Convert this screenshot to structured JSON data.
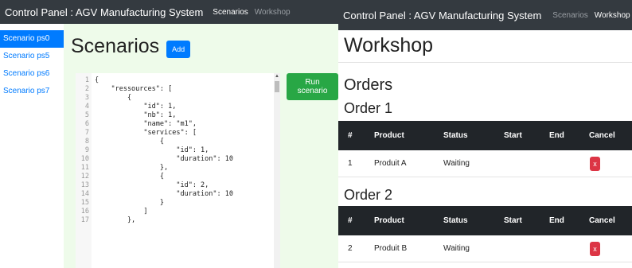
{
  "left": {
    "navbar": {
      "brand": "Control Panel : AGV Manufacturing System",
      "links": [
        "Scenarios",
        "Workshop"
      ]
    },
    "sidebar": {
      "items": [
        "Scenario ps0",
        "Scenario ps5",
        "Scenario ps6",
        "Scenario ps7"
      ],
      "active_index": 0
    },
    "title": "Scenarios",
    "add_label": "Add",
    "run_label": "Run scenario",
    "editor_lines": [
      "{",
      "    \"ressources\": [",
      "        {",
      "            \"id\": 1,",
      "            \"nb\": 1,",
      "            \"name\": \"m1\",",
      "            \"services\": [",
      "                {",
      "                    \"id\": 1,",
      "                    \"duration\": 10",
      "                },",
      "                {",
      "                    \"id\": 2,",
      "                    \"duration\": 10",
      "                }",
      "            ]",
      "        },"
    ]
  },
  "right": {
    "navbar": {
      "brand": "Control Panel : AGV Manufacturing System",
      "links": [
        "Scenarios",
        "Workshop"
      ]
    },
    "title": "Workshop",
    "orders_heading": "Orders",
    "columns": [
      "#",
      "Product",
      "Status",
      "Start",
      "End",
      "Cancel"
    ],
    "orders": [
      {
        "heading": "Order 1",
        "rows": [
          {
            "id": "1",
            "product": "Produit A",
            "status": "Waiting",
            "start": "",
            "end": "",
            "cancel": "x"
          }
        ]
      },
      {
        "heading": "Order 2",
        "rows": [
          {
            "id": "2",
            "product": "Produit B",
            "status": "Waiting",
            "start": "",
            "end": "",
            "cancel": "x"
          }
        ]
      }
    ]
  },
  "colors": {
    "navbar_bg": "#343a40",
    "primary": "#007bff",
    "success": "#28a745",
    "danger": "#dc3545",
    "table_header_bg": "#212529",
    "content_bg": "#eefbea"
  }
}
